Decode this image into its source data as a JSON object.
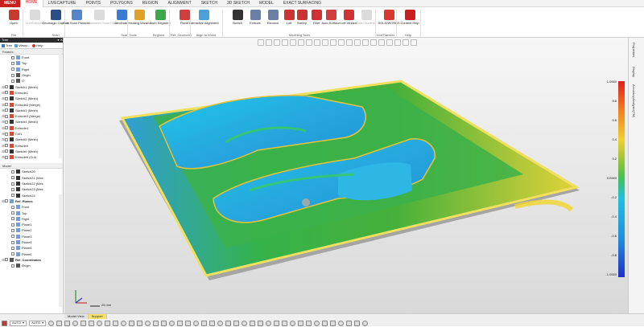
{
  "menubar": {
    "file": "MENU",
    "tabs": [
      "HOME",
      "LIVECAPTURE",
      "POINTS",
      "POLYGONS",
      "REGION",
      "ALIGNMENT",
      "SKETCH",
      "3D SKETCH",
      "MODEL",
      "EXACT SURFACING"
    ],
    "active": "HOME"
  },
  "ribbon": {
    "buttons": [
      {
        "name": "open",
        "label": "Open",
        "color": "#c63b2e"
      },
      {
        "name": "livecapture",
        "label": "LiveCapture",
        "color": "#999",
        "disabled": true
      },
      {
        "name": "geomagic-capture",
        "label": "Geomagic Capture",
        "color": "#2b4f84"
      },
      {
        "name": "run-scan-process",
        "label": "Run Scan Process",
        "color": "#5585c8"
      },
      {
        "name": "align-between-scan-data",
        "label": "Align Between Scan Data",
        "color": "#999",
        "disabled": true
      },
      {
        "name": "decimate",
        "label": "Decimate",
        "color": "#3a7bd5"
      },
      {
        "name": "healing-wizard",
        "label": "Healing Wizard",
        "color": "#e0a12a"
      },
      {
        "name": "auto-segment",
        "label": "Auto Segment",
        "color": "#3da74a"
      },
      {
        "name": "plane",
        "label": "Plane",
        "color": "#d13e3e"
      },
      {
        "name": "interactive-alignment",
        "label": "Interactive Alignment",
        "color": "#4aa0d8"
      },
      {
        "name": "sketch",
        "label": "Sketch",
        "color": "#333"
      },
      {
        "name": "extrude",
        "label": "Extrude",
        "color": "#6a7fa8"
      },
      {
        "name": "revolve",
        "label": "Revolve",
        "color": "#6a7fa8"
      },
      {
        "name": "loft",
        "label": "Loft",
        "color": "#c33"
      },
      {
        "name": "sweep",
        "label": "Sweep",
        "color": "#c33"
      },
      {
        "name": "fillet",
        "label": "Fillet",
        "color": "#c33"
      },
      {
        "name": "auto-surface",
        "label": "Auto Surface",
        "color": "#d13e3e"
      },
      {
        "name": "loft-wizard",
        "label": "Loft Wizard",
        "color": "#c33"
      },
      {
        "name": "solid-modeler",
        "label": "Solid Modeler",
        "color": "#999",
        "disabled": true
      },
      {
        "name": "solidworks",
        "label": "SOLIDWORKS",
        "color": "#d63a2c"
      },
      {
        "name": "context-help",
        "label": "Context Help",
        "color": "#c8201e"
      }
    ],
    "groups": [
      "File",
      "Scan",
      "Scan Tools",
      "Regions",
      "Ref. Geometry",
      "Align to World",
      "Modeling Tools",
      "LiveTransfer",
      "Help"
    ]
  },
  "left_panel": {
    "title": "Tree",
    "tabs": [
      "Tree",
      "Viewp...",
      "Help"
    ],
    "feature_header": "Feature",
    "features": [
      {
        "label": "Front",
        "icon": "plane-icon",
        "indent": 1
      },
      {
        "label": "Top",
        "icon": "plane-icon",
        "indent": 1
      },
      {
        "label": "Right",
        "icon": "plane-icon",
        "indent": 1
      },
      {
        "label": "Origin",
        "icon": "origin-icon",
        "indent": 1
      },
      {
        "label": "∅",
        "icon": "origin-icon",
        "indent": 1
      },
      {
        "label": "Sketch1 (Mesh)",
        "icon": "sketch-icon",
        "indent": 0
      },
      {
        "label": "Extrude1",
        "icon": "extrude-icon",
        "indent": 0
      },
      {
        "label": "Sketch2 (Mesh)",
        "icon": "sketch-icon",
        "indent": 0
      },
      {
        "label": "Extrude2 (Merge)",
        "icon": "extrude-icon",
        "indent": 0
      },
      {
        "label": "Sketch3 (Mesh)",
        "icon": "sketch-icon",
        "indent": 0
      },
      {
        "label": "Extrude3 (Merge)",
        "icon": "extrude-icon",
        "indent": 0
      },
      {
        "label": "Sketch4 (Mesh)",
        "icon": "sketch-icon",
        "indent": 0
      },
      {
        "label": "Extrude4",
        "icon": "extrude-icon",
        "indent": 0
      },
      {
        "label": "Cut1",
        "icon": "extrude-icon",
        "indent": 0
      },
      {
        "label": "Sketch5 (Mesh)",
        "icon": "sketch-icon",
        "indent": 0
      },
      {
        "label": "Extrude5",
        "icon": "extrude-icon",
        "indent": 0
      },
      {
        "label": "Sketch6 (Mesh)",
        "icon": "sketch-icon",
        "indent": 0
      },
      {
        "label": "Extrude6 (Cut)",
        "icon": "extrude-icon",
        "indent": 0
      }
    ],
    "model_header": "Model",
    "model": [
      {
        "label": "Sketch20",
        "icon": "sketch-icon",
        "indent": 1
      },
      {
        "label": "Sketch21 (Mes",
        "icon": "sketch-icon",
        "indent": 1
      },
      {
        "label": "Sketch22 (Mes",
        "icon": "sketch-icon",
        "indent": 1
      },
      {
        "label": "Sketch23 (Mes",
        "icon": "sketch-icon",
        "indent": 1
      },
      {
        "label": "Sketch24",
        "icon": "sketch-icon",
        "indent": 1
      },
      {
        "label": "Ref. Planes",
        "icon": "plane-icon",
        "indent": 0,
        "bold": true
      },
      {
        "label": "Front",
        "icon": "plane-icon",
        "indent": 1
      },
      {
        "label": "Top",
        "icon": "plane-icon",
        "indent": 1
      },
      {
        "label": "Right",
        "icon": "plane-icon",
        "indent": 1
      },
      {
        "label": "Plane1",
        "icon": "plane-icon",
        "indent": 1
      },
      {
        "label": "Plane2",
        "icon": "plane-icon",
        "indent": 1
      },
      {
        "label": "Plane3",
        "icon": "plane-icon",
        "indent": 1
      },
      {
        "label": "Plane4",
        "icon": "plane-icon",
        "indent": 1
      },
      {
        "label": "Plane5",
        "icon": "plane-icon",
        "indent": 1
      },
      {
        "label": "Plane6",
        "icon": "plane-icon",
        "indent": 1
      },
      {
        "label": "Ref. Coordinates",
        "icon": "origin-icon",
        "indent": 0,
        "bold": true
      },
      {
        "label": "Origin",
        "icon": "origin-icon",
        "indent": 1
      }
    ]
  },
  "viewport": {
    "scale_label": "25 mm"
  },
  "color_legend": {
    "stops": [
      "1.0000",
      "0.8",
      "0.6",
      "0.4",
      "0.2",
      "0.0000",
      "-0.2",
      "-0.4",
      "-0.6",
      "-0.8",
      "-1.0000"
    ]
  },
  "right_tabs": [
    "Properties",
    "Display",
    "Accuracy Analyzer(TM)"
  ],
  "bottom": {
    "doc_tabs": [
      "Model View",
      "Support"
    ],
    "active_tab": "Support",
    "select_mode": "AUTO",
    "select_filter": "AUTO"
  }
}
